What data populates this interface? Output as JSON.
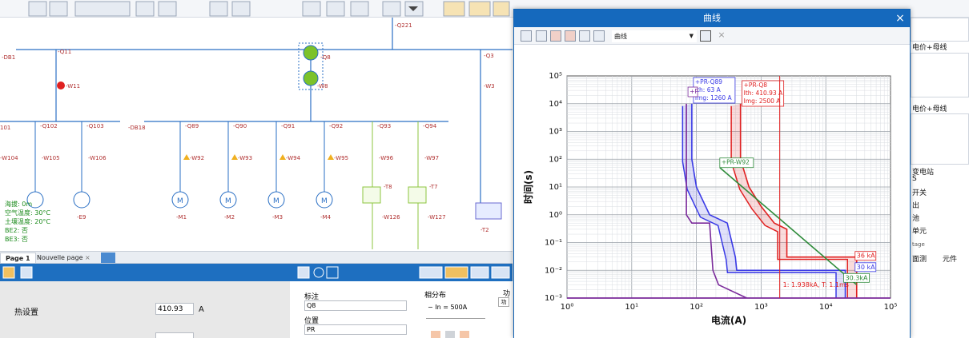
{
  "schematic": {
    "breakers": [
      "-Q221",
      "-Q11",
      "-Q8",
      "-Q3",
      "-Q102",
      "-Q103",
      "-Q89",
      "-Q90",
      "-Q91",
      "-Q92",
      "-Q93",
      "-Q94"
    ],
    "bus_labels": [
      "-DB1",
      "-DB18",
      "101"
    ],
    "cables": [
      "-W11",
      "-W105",
      "-W106",
      "-W104",
      "-W92",
      "-W93",
      "-W94",
      "-W95",
      "-W96",
      "-W97",
      "-W126",
      "-W127",
      "-W3",
      "-W8"
    ],
    "loads": [
      "-E9",
      "-M1",
      "-M2",
      "-M3",
      "-M4",
      "-T8",
      "-T7",
      "-T2"
    ],
    "motor_symbol": "M",
    "info_block": [
      "海拔: 0m",
      "空气温度: 30°C",
      "土壤温度: 20°C",
      "BE2: 否",
      "BE3: 否"
    ]
  },
  "tabs": [
    "Page 1",
    "Nouvelle page"
  ],
  "tab_close": "×",
  "properties": {
    "thermal_label": "热设置",
    "thermal_value": "410.93",
    "thermal_unit": "A",
    "annotation_label": "标注",
    "annotation_value": "Q8",
    "position_label": "位置",
    "position_value": "PR",
    "phase_label": "相分布",
    "in_label": "− In = 500A",
    "function_label": "功",
    "fn_tag": "功"
  },
  "dialog": {
    "title": "曲线",
    "close_symbol": "×",
    "curve_select": "曲线",
    "dropdown_arrow": "▼"
  },
  "chart_data": {
    "type": "line",
    "xlabel": "电流(A)",
    "ylabel": "时间(s)",
    "x_scale": "log",
    "y_scale": "log",
    "xlim": [
      1,
      100000
    ],
    "ylim": [
      0.001,
      100000
    ],
    "x_ticks": [
      "10⁰",
      "10¹",
      "10²",
      "10³",
      "10⁴",
      "10⁵"
    ],
    "y_ticks": [
      "10⁻³",
      "10⁻²",
      "10⁻¹",
      "10⁰",
      "10¹",
      "10²",
      "10³",
      "10⁴",
      "10⁵"
    ],
    "grid": true,
    "series": [
      {
        "name": "PR-Q89",
        "color": "#3a3ae6",
        "label_lines": [
          "+PR-Q89",
          "Ith: 63 A",
          "Img: 1260 A"
        ],
        "x": [
          85,
          85,
          100,
          160,
          300,
          400,
          420,
          2000,
          20000,
          20000
        ],
        "y": [
          10000,
          100,
          10,
          1,
          0.5,
          0.03,
          0.01,
          0.01,
          0.01,
          0.001
        ]
      },
      {
        "name": "PR-Q8",
        "color": "#e02020",
        "label_lines": [
          "+PR-Q8",
          "Ith: 410.93 A",
          "Img: 2500 A"
        ],
        "x": [
          480,
          480,
          650,
          1000,
          1600,
          2500,
          2500,
          8000,
          30000,
          30000
        ],
        "y": [
          10000,
          100,
          10,
          2,
          0.5,
          0.3,
          0.03,
          0.03,
          0.03,
          0.001
        ]
      },
      {
        "name": "PR-W92",
        "color": "#2e8b3a",
        "label_lines": [
          "+PR-W92"
        ],
        "x": [
          230,
          30000
        ],
        "y": [
          50,
          0.003
        ]
      },
      {
        "name": "P",
        "color": "#7a2a9a",
        "label_lines": [
          "+P"
        ],
        "x": [
          70,
          70,
          85,
          160,
          180,
          220,
          600
        ],
        "y": [
          10000,
          1,
          0.5,
          0.5,
          0.01,
          0.003,
          0.001
        ]
      }
    ],
    "annotations": [
      {
        "text": "36 kA",
        "color": "#e02020"
      },
      {
        "text": "30 kA",
        "color": "#3a3ae6"
      },
      {
        "text": "30.3kA",
        "color": "#2e8b3a"
      },
      {
        "text": "1: 1.938kA, T: 1.1ms",
        "color": "#e02020"
      }
    ],
    "cursor_x": 1938
  },
  "right_panel": {
    "items": [
      "电价+母线",
      "电价+母线",
      "变电站",
      "S",
      "开关",
      "出",
      "池",
      "单元",
      "tage",
      "面测",
      "元件"
    ]
  }
}
